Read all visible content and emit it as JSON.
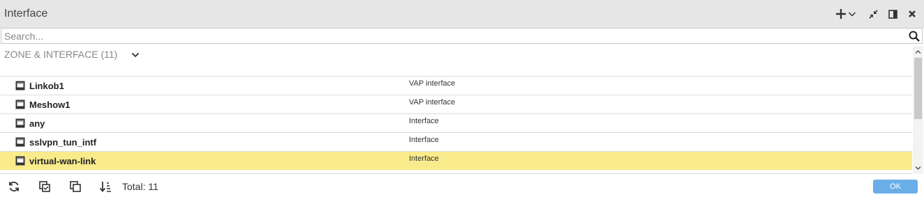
{
  "window": {
    "title": "Interface"
  },
  "header_icons": [
    "plus-icon",
    "chevron-down-icon",
    "minimize-icon",
    "panel-toggle-icon",
    "close-icon"
  ],
  "search": {
    "placeholder": "Search...",
    "value": ""
  },
  "group": {
    "label": "ZONE & INTERFACE (11)",
    "expanded": true
  },
  "rows": [
    {
      "name": "Linkob1",
      "type": "VAP interface",
      "selected": false
    },
    {
      "name": "Meshow1",
      "type": "VAP interface",
      "selected": false
    },
    {
      "name": "any",
      "type": "Interface",
      "selected": false
    },
    {
      "name": "sslvpn_tun_intf",
      "type": "Interface",
      "selected": false
    },
    {
      "name": "virtual-wan-link",
      "type": "Interface",
      "selected": true
    }
  ],
  "footer": {
    "total_label": "Total: 11",
    "ok_label": "OK"
  },
  "colors": {
    "header_bg": "#e6e6e6",
    "selected_row": "#f9eb8c",
    "ok_button": "#6aaee8"
  }
}
